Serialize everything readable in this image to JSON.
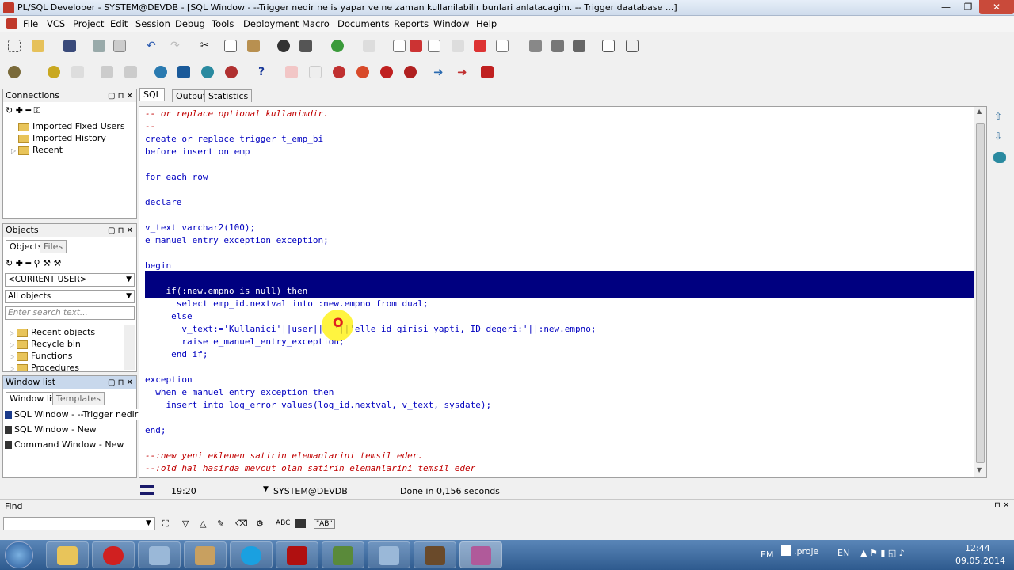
{
  "window": {
    "title": "PL/SQL Developer - SYSTEM@DEVDB - [SQL Window - --Trigger nedir ne is yapar ve ne zaman kullanilabilir bunlari anlatacagim. -- Trigger daatabase ...]",
    "min_glyph": "—",
    "max_glyph": "❐",
    "close_glyph": "✕"
  },
  "menu": [
    "File",
    "VCS",
    "Project",
    "Edit",
    "Session",
    "Debug",
    "Tools",
    "Deployment",
    "Macro",
    "Documents",
    "Reports",
    "Window",
    "Help"
  ],
  "connections": {
    "title": "Connections",
    "items": [
      "Imported Fixed Users",
      "Imported History",
      "Recent"
    ]
  },
  "objects": {
    "title": "Objects",
    "tabs": [
      "Objects",
      "Files"
    ],
    "user_combo": "<CURRENT USER>",
    "type_combo": "All objects",
    "search_placeholder": "Enter search text...",
    "items": [
      "Recent objects",
      "Recycle bin",
      "Functions",
      "Procedures"
    ]
  },
  "window_list": {
    "title": "Window list",
    "tabs": [
      "Window list",
      "Templates"
    ],
    "items": [
      "SQL Window - --Trigger nedir ne is",
      "SQL Window - New",
      "Command Window - New"
    ]
  },
  "editor": {
    "tabs": [
      "SQL",
      "Output",
      "Statistics"
    ],
    "lines": [
      "-- or replace optional kullanimdir.",
      "--",
      "create or replace trigger t_emp_bi",
      "before insert on emp",
      "",
      "for each row",
      "",
      "declare",
      "",
      "v_text varchar2(100);",
      "e_manuel_entry_exception exception;",
      "",
      "begin",
      "",
      "    if(:new.empno is null) then",
      "      select emp_id.nextval into :new.empno from dual;",
      "     else",
      "       v_text:='Kullanici'||user||' '||'elle id girisi yapti, ID degeri:'||:new.empno;",
      "       raise e_manuel_entry_exception;",
      "     end if;",
      "",
      "exception",
      "  when e_manuel_entry_exception then",
      "    insert into log_error values(log_id.nextval, v_text, sysdate);",
      "",
      "end;",
      "",
      "--:new yeni eklenen satirin elemanlarini temsil eder.",
      "--:old hal hasirda mevcut olan satirin elemanlarini temsil eder"
    ]
  },
  "status": {
    "position": "19:20",
    "connection": "SYSTEM@DEVDB",
    "message": "Done in 0,156 seconds"
  },
  "find": {
    "label": "Find",
    "value": "",
    "opt1": "ABC",
    "opt2": "\"AB\""
  },
  "taskbar": {
    "lang1": "EM",
    "doc_label": ".proje",
    "lang2": "EN",
    "time": "12:44",
    "date": "09.05.2014"
  }
}
